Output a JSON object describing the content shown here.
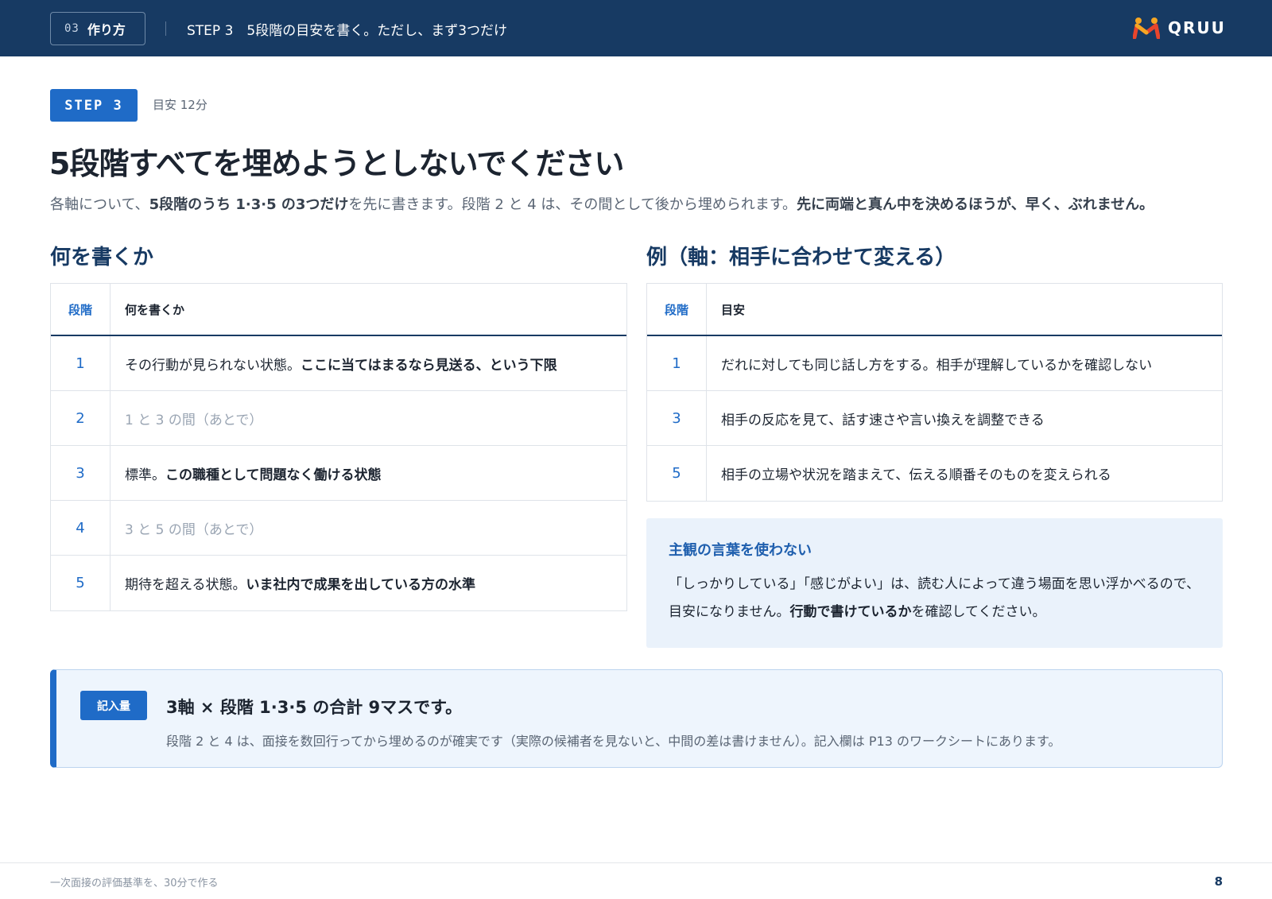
{
  "header": {
    "section_number": "03",
    "section_name": "作り方",
    "step_title": "STEP 3　5段階の目安を書く。ただし、まず3つだけ",
    "logo_text": "QRUU",
    "bg_color": "#173a63"
  },
  "step": {
    "badge": "STEP 3",
    "time": "目安 12分"
  },
  "title": "5段階すべてを埋めようとしないでください",
  "lead": {
    "t1": "各軸について、",
    "b1": "5段階のうち 1·3·5 の3つだけ",
    "t2": "を先に書きます。段階 2 と 4 は、その間として後から埋められます。",
    "b2": "先に両端と真ん中を決めるほうが、早く、ぶれません。"
  },
  "left": {
    "heading": "何を書くか",
    "col_stage": "段階",
    "col_content": "何を書くか",
    "rows": [
      {
        "num": "1",
        "plain": "その行動が見られない状態。",
        "bold": "ここに当てはまるなら見送る、という下限"
      },
      {
        "num": "2",
        "plain": "1 と 3 の間（あとで）",
        "bold": ""
      },
      {
        "num": "3",
        "plain": "標準。",
        "bold": "この職種として問題なく働ける状態"
      },
      {
        "num": "4",
        "plain": "3 と 5 の間（あとで）",
        "bold": ""
      },
      {
        "num": "5",
        "plain": "期待を超える状態。",
        "bold": "いま社内で成果を出している方の水準"
      }
    ]
  },
  "right": {
    "heading": "例（軸：相手に合わせて変える）",
    "col_stage": "段階",
    "col_content": "目安",
    "rows": [
      {
        "num": "1",
        "text": "だれに対しても同じ話し方をする。相手が理解しているかを確認しない"
      },
      {
        "num": "3",
        "text": "相手の反応を見て、話す速さや言い換えを調整できる"
      },
      {
        "num": "5",
        "text": "相手の立場や状況を踏まえて、伝える順番そのものを変えられる"
      }
    ]
  },
  "note": {
    "title": "主観の言葉を使わない",
    "line1": "「しっかりしている」「感じがよい」は、読む人によって違う場面を思い浮かべるので、",
    "line2_a": "目安になりません。",
    "line2_b": "行動で書けているか",
    "line2_c": "を確認してください。"
  },
  "summary": {
    "badge": "記入量",
    "title": "3軸 × 段階 1·3·5 の合計 9マスです。",
    "text": "段階 2 と 4 は、面接を数回行ってから埋めるのが確実です（実際の候補者を見ないと、中間の差は書けません）。記入欄は P13 のワークシートにあります。"
  },
  "footer": {
    "doc_title": "一次面接の評価基準を、30分で作る",
    "page": "8"
  }
}
